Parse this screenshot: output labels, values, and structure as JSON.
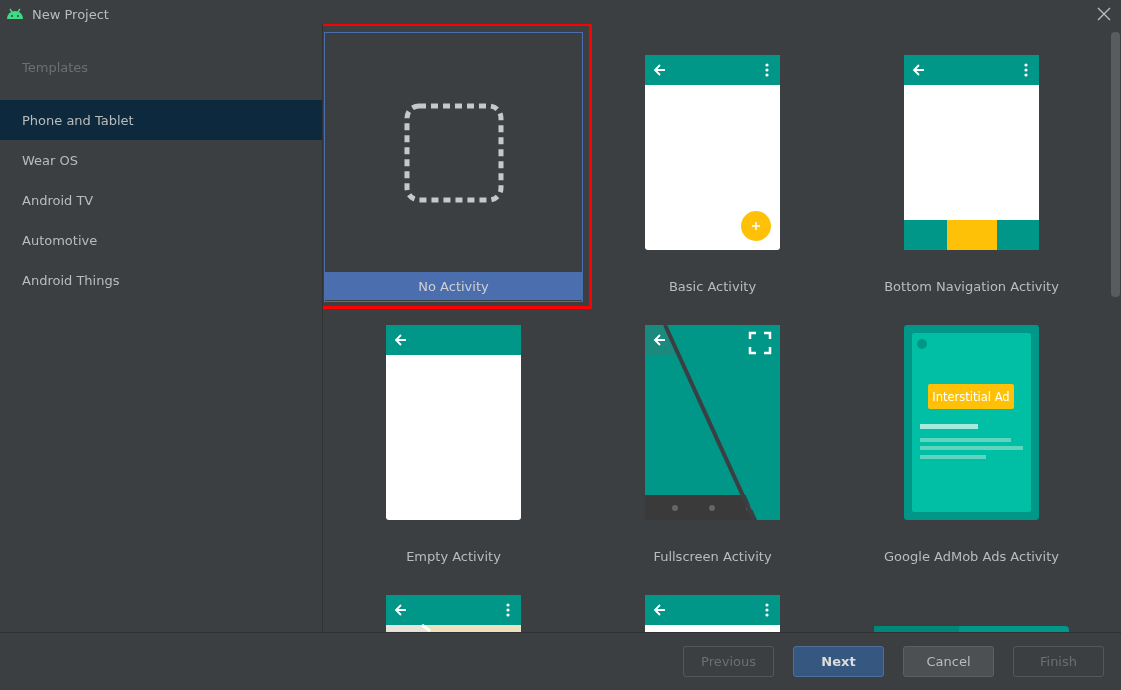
{
  "window": {
    "title": "New Project"
  },
  "sidebar": {
    "heading": "Templates",
    "items": [
      {
        "label": "Phone and Tablet",
        "selected": true
      },
      {
        "label": "Wear OS",
        "selected": false
      },
      {
        "label": "Android TV",
        "selected": false
      },
      {
        "label": "Automotive",
        "selected": false
      },
      {
        "label": "Android Things",
        "selected": false
      }
    ]
  },
  "templates": [
    {
      "kind": "none",
      "label": "No Activity",
      "selected": true,
      "highlighted": true
    },
    {
      "kind": "basic",
      "label": "Basic Activity",
      "selected": false,
      "highlighted": false
    },
    {
      "kind": "bottom_nav",
      "label": "Bottom Navigation Activity",
      "selected": false,
      "highlighted": false
    },
    {
      "kind": "empty",
      "label": "Empty Activity",
      "selected": false,
      "highlighted": false
    },
    {
      "kind": "fullscreen",
      "label": "Fullscreen Activity",
      "selected": false,
      "highlighted": false
    },
    {
      "kind": "admob",
      "label": "Google AdMob Ads Activity",
      "ad_text": "Interstitial Ad",
      "selected": false,
      "highlighted": false
    },
    {
      "kind": "maps",
      "selected": false,
      "highlighted": false
    },
    {
      "kind": "basic_top",
      "selected": false,
      "highlighted": false
    },
    {
      "kind": "wide",
      "selected": false,
      "highlighted": false
    }
  ],
  "buttons": [
    {
      "label": "Previous",
      "kind": "secondary",
      "disabled": true
    },
    {
      "label": "Next",
      "kind": "primary",
      "disabled": false
    },
    {
      "label": "Cancel",
      "kind": "secondary",
      "disabled": false
    },
    {
      "label": "Finish",
      "kind": "secondary",
      "disabled": true
    }
  ]
}
